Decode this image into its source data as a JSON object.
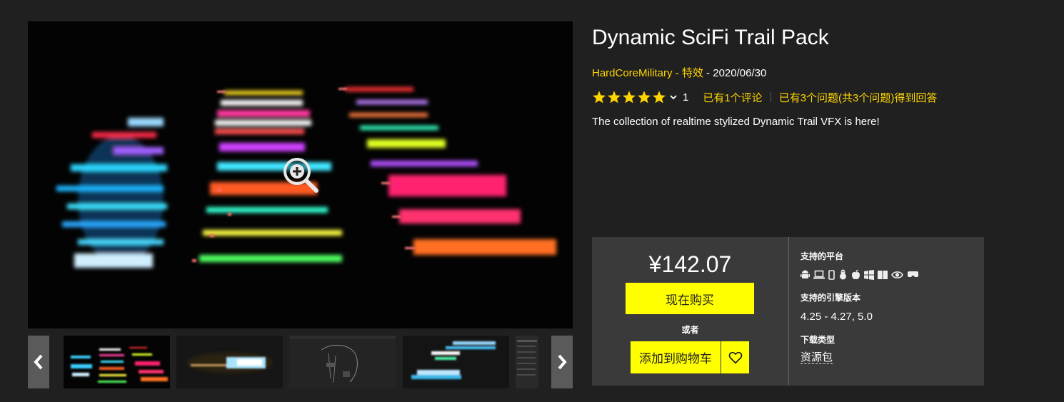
{
  "product": {
    "title": "Dynamic SciFi Trail Pack",
    "seller": "HardCoreMilitary",
    "separator": " - ",
    "category": "特效",
    "date": "2020/06/30",
    "description": "The collection of realtime stylized Dynamic Trail VFX is here!"
  },
  "rating": {
    "stars": 5,
    "count": "1",
    "reviews_text": "已有1个评论",
    "questions_text": "已有3个问题(共3个问题)得到回答"
  },
  "purchase": {
    "price": "¥142.07",
    "buy_label": "现在购买",
    "or_label": "或者",
    "cart_label": "添加到购物车"
  },
  "details": {
    "platforms_label": "支持的平台",
    "platform_icons": [
      "android-icon",
      "laptop-icon",
      "mobile-icon",
      "linux-icon",
      "apple-icon",
      "windows-icon",
      "windows-icon",
      "eye-icon",
      "headset-icon"
    ],
    "engine_label": "支持的引擎版本",
    "engine_versions": "4.25 - 4.27, 5.0",
    "download_label": "下载类型",
    "download_type": "资源包"
  },
  "gallery": {
    "thumbnails": [
      "thumbnail-trails-overview",
      "thumbnail-blue-trail",
      "thumbnail-node-graph",
      "thumbnail-cyan-trails",
      "thumbnail-editor"
    ],
    "selected": 0
  },
  "colors": {
    "background": "#202020",
    "accent_text": "#ffd500",
    "button": "#ffff00",
    "panel": "#3a3a3a"
  }
}
